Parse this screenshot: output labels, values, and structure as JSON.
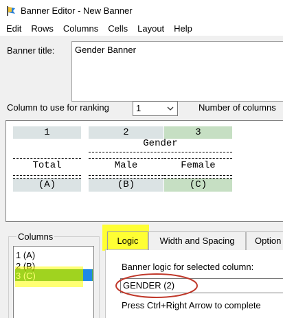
{
  "window": {
    "title": "Banner Editor - New Banner",
    "icon": "banner-app-icon"
  },
  "menu": [
    "Edit",
    "Rows",
    "Columns",
    "Cells",
    "Layout",
    "Help"
  ],
  "banner_title": {
    "label": "Banner title:",
    "value": "Gender Banner"
  },
  "ranking": {
    "label": "Column to use for ranking",
    "selected": "1",
    "num_columns_label": "Number of columns"
  },
  "preview": {
    "column_numbers": [
      "1",
      "2",
      "3"
    ],
    "group_label": "Gender",
    "column_labels": [
      "Total",
      "Male",
      "Female"
    ],
    "column_letters": [
      "(A)",
      "(B)",
      "(C)"
    ],
    "selected_column": 3
  },
  "columns_panel": {
    "label": "Columns",
    "items": [
      "1 (A)",
      "2 (B)",
      "3 (C)"
    ],
    "selected_index": 2
  },
  "tabs": {
    "logic": "Logic",
    "width": "Width and Spacing",
    "options": "Option"
  },
  "logic_panel": {
    "label": "Banner logic for selected column:",
    "value": "GENDER (2)",
    "hint": "Press Ctrl+Right Arrow to complete"
  },
  "colors": {
    "selected_column_header": "#c6dfc3",
    "column_header": "#dbe3e4",
    "list_selection": "#2e9e45",
    "highlight_yellow": "#ffff33",
    "annotation_red": "#c0392b"
  }
}
